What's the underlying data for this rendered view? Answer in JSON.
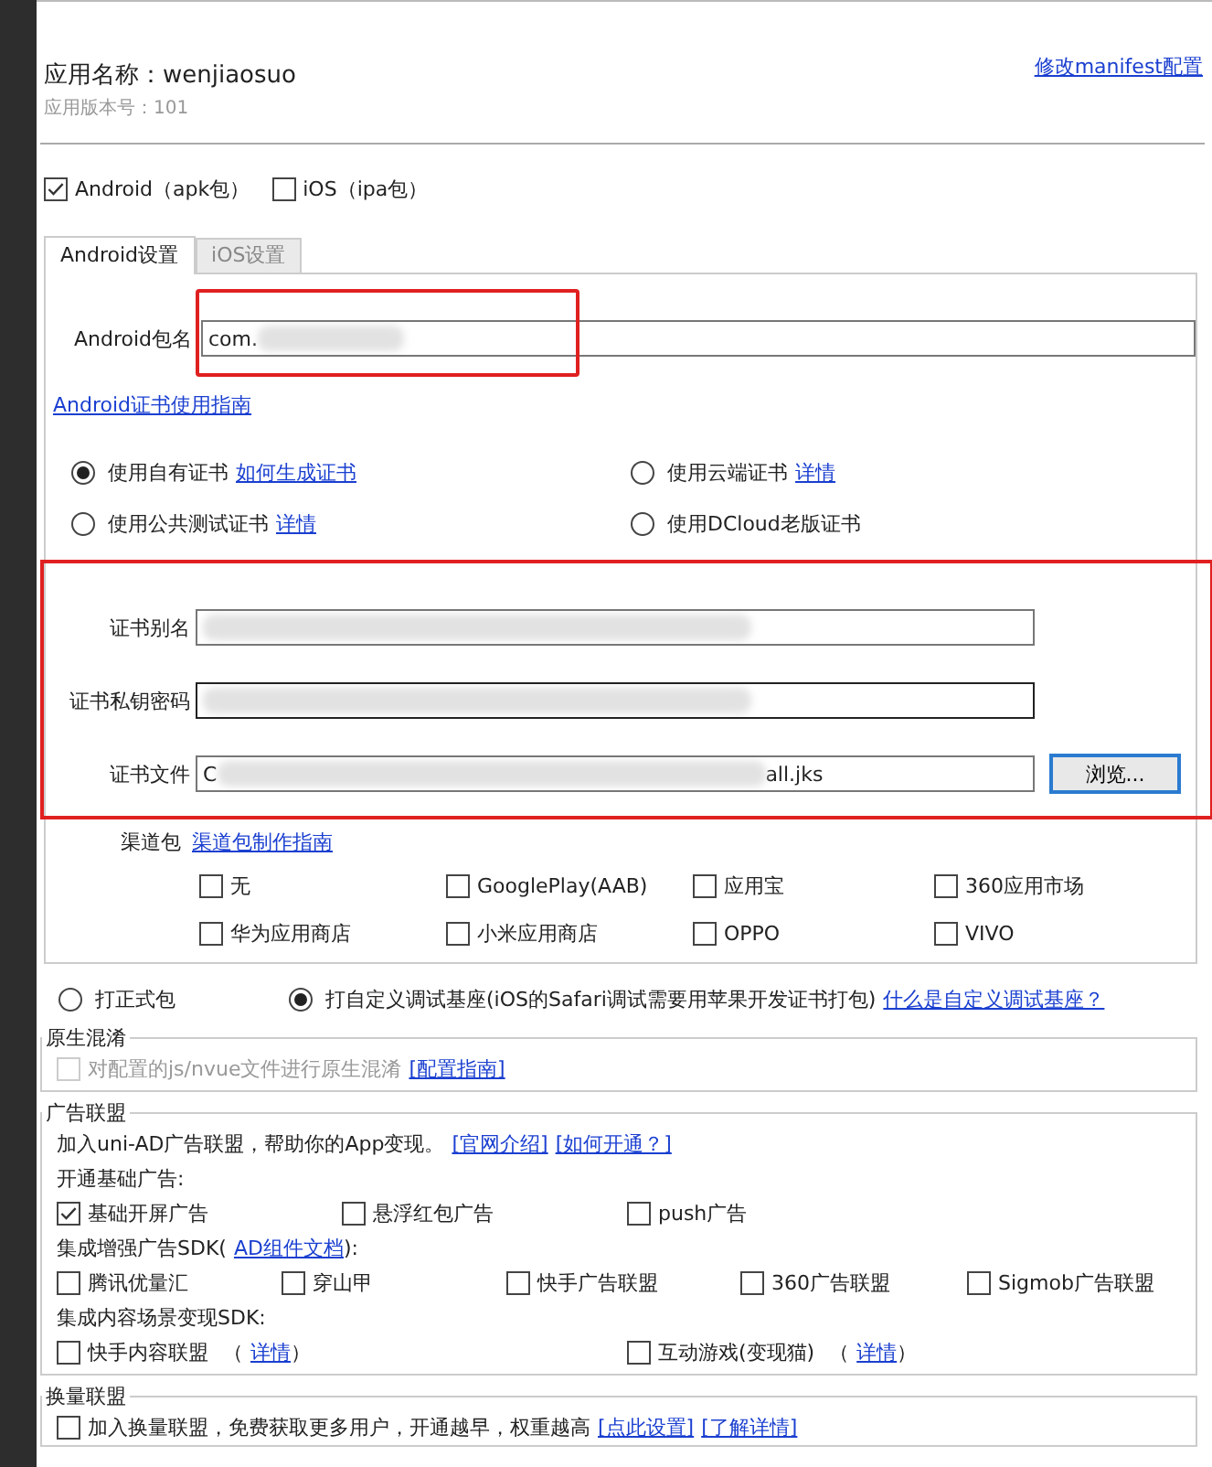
{
  "app": {
    "name_label": "应用名称：",
    "name": "wenjiaosuo",
    "version": "应用版本号：101",
    "manifest_link": "修改manifest配置"
  },
  "platforms": [
    {
      "label": "Android（apk包）",
      "checked": true
    },
    {
      "label": "iOS（ipa包）",
      "checked": false
    }
  ],
  "tabs": [
    {
      "label": "Android设置",
      "selected": true
    },
    {
      "label": "iOS设置",
      "selected": false
    }
  ],
  "android": {
    "package_label": "Android包名",
    "package_value": "com.",
    "package_redacted": true,
    "package_highlighted": true,
    "cert_guide_link": "Android证书使用指南",
    "cert_options": [
      {
        "label": "使用自有证书",
        "link": "如何生成证书",
        "selected": true
      },
      {
        "label": "使用云端证书",
        "link": "详情",
        "selected": false
      },
      {
        "label": "使用公共测试证书",
        "link": "详情",
        "selected": false
      },
      {
        "label": "使用DCloud老版证书",
        "selected": false
      }
    ],
    "cert_fields_highlighted": true,
    "cert_fields": [
      {
        "label": "证书别名",
        "redacted": true
      },
      {
        "label": "证书私钥密码",
        "redacted": true
      },
      {
        "label": "证书文件",
        "value": "C",
        "value_end": "all.jks",
        "redacted": true
      }
    ],
    "browse_button": "浏览...",
    "channel_label": "渠道包",
    "channel_link": "渠道包制作指南",
    "channels": [
      {
        "label": "无",
        "checked": false
      },
      {
        "label": "GooglePlay(AAB)",
        "checked": false
      },
      {
        "label": "应用宝",
        "checked": false
      },
      {
        "label": "360应用市场",
        "checked": false
      },
      {
        "label": "华为应用商店",
        "checked": false
      },
      {
        "label": "小米应用商店",
        "checked": false
      },
      {
        "label": "OPPO",
        "checked": false
      },
      {
        "label": "VIVO",
        "checked": false
      }
    ]
  },
  "build_types": [
    {
      "label": "打正式包",
      "selected": false
    },
    {
      "label": "打自定义调试基座(iOS的Safari调试需要用苹果开发证书打包)",
      "selected": true
    }
  ],
  "build_link": "什么是自定义调试基座？",
  "obfuscation": {
    "title": "原生混淆",
    "label": "对配置的js/nvue文件进行原生混淆",
    "checked": false,
    "disabled": true,
    "link": "[配置指南]"
  },
  "ad_union": {
    "title": "广告联盟",
    "intro": "加入uni-AD广告联盟，帮助你的App变现。",
    "links": [
      "[官网介绍]",
      "[如何开通？]"
    ],
    "basic_heading": "开通基础广告:",
    "basic": [
      {
        "label": "基础开屏广告",
        "checked": true
      },
      {
        "label": "悬浮红包广告",
        "checked": false
      },
      {
        "label": "push广告",
        "checked": false
      }
    ],
    "sdk_heading": "集成增强广告SDK(",
    "sdk_link": "AD组件文档",
    "sdk_heading_end": "):",
    "sdk": [
      {
        "label": "腾讯优量汇",
        "checked": false
      },
      {
        "label": "穿山甲",
        "checked": false
      },
      {
        "label": "快手广告联盟",
        "checked": false
      },
      {
        "label": "360广告联盟",
        "checked": false
      },
      {
        "label": "Sigmob广告联盟",
        "checked": false
      }
    ],
    "content_heading": "集成内容场景变现SDK:",
    "content": [
      {
        "label": "快手内容联盟",
        "open": "（",
        "link": "详情",
        "close": "）",
        "checked": false
      },
      {
        "label": "互动游戏(变现猫)",
        "open": "（",
        "link": "详情",
        "close": "）",
        "checked": false
      }
    ]
  },
  "swap_union": {
    "title": "换量联盟",
    "label": "加入换量联盟，免费获取更多用户，开通越早，权重越高",
    "checked": false,
    "links": [
      "[点此设置]",
      "[了解详情]"
    ]
  }
}
